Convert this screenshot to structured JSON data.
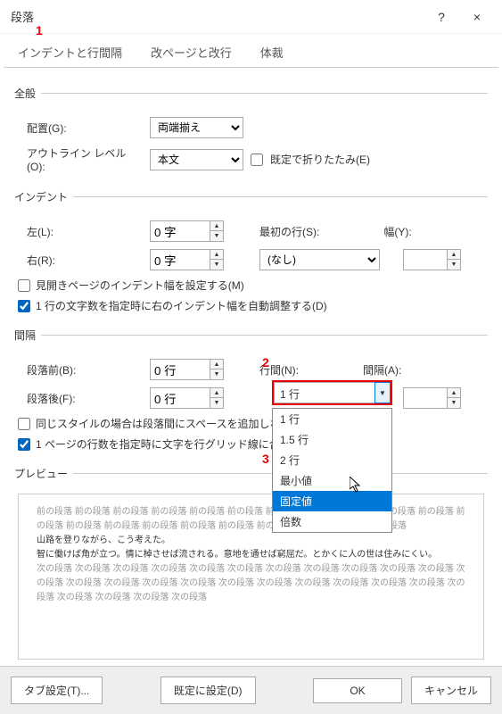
{
  "titlebar": {
    "title": "段落",
    "help": "?",
    "close": "×"
  },
  "annotations": {
    "one": "1",
    "two": "2",
    "three": "3"
  },
  "tabs": {
    "t1": "インデントと行間隔",
    "t2": "改ページと改行",
    "t3": "体裁"
  },
  "general": {
    "legend": "全般",
    "align_label": "配置(G):",
    "align_value": "両端揃え",
    "outline_label": "アウトライン レベル(O):",
    "outline_value": "本文",
    "collapse_label": "既定で折りたたみ(E)"
  },
  "indent": {
    "legend": "インデント",
    "left_label": "左(L):",
    "left_value": "0 字",
    "right_label": "右(R):",
    "right_value": "0 字",
    "firstline_label": "最初の行(S):",
    "firstline_value": "(なし)",
    "width_label": "幅(Y):",
    "width_value": "",
    "mirror_label": "見開きページのインデント幅を設定する(M)",
    "autoadj_label": "1 行の文字数を指定時に右のインデント幅を自動調整する(D)"
  },
  "spacing": {
    "legend": "間隔",
    "before_label": "段落前(B):",
    "before_value": "0 行",
    "after_label": "段落後(F):",
    "after_value": "0 行",
    "line_label": "行間(N):",
    "line_value": "1 行",
    "at_label": "間隔(A):",
    "at_value": "",
    "samestyle_label": "同じスタイルの場合は段落間にスペースを追加しない",
    "snapgrid_label": "1 ページの行数を指定時に文字を行グリッド線に合わせる"
  },
  "dropdown": {
    "opt1": "1 行",
    "opt2": "1.5 行",
    "opt3": "2 行",
    "opt4": "最小値",
    "opt5": "固定値",
    "opt6": "倍数"
  },
  "preview": {
    "legend": "プレビュー",
    "para_repeat_before": "前の段落 前の段落 前の段落 前の段落 前の段落 前の段落 前の段落 前の段落 前の段落 前の段落 前の段落 前の段落 前の段落 前の段落 前の段落 前の段落 前の段落 前の段落 前の段落 前の段落 前の段落",
    "sample1": "山路を登りながら、こう考えた。",
    "sample2": "智に働けば角が立つ。情に棹させば流される。意地を通せば窮屈だ。とかくに人の世は住みにくい。",
    "para_repeat_after": "次の段落 次の段落 次の段落 次の段落 次の段落 次の段落 次の段落 次の段落 次の段落 次の段落 次の段落 次の段落 次の段落 次の段落 次の段落 次の段落 次の段落 次の段落 次の段落 次の段落 次の段落 次の段落 次の段落 次の段落 次の段落 次の段落 次の段落"
  },
  "footer": {
    "tabstops": "タブ設定(T)...",
    "setdefault": "既定に設定(D)",
    "ok": "OK",
    "cancel": "キャンセル"
  }
}
